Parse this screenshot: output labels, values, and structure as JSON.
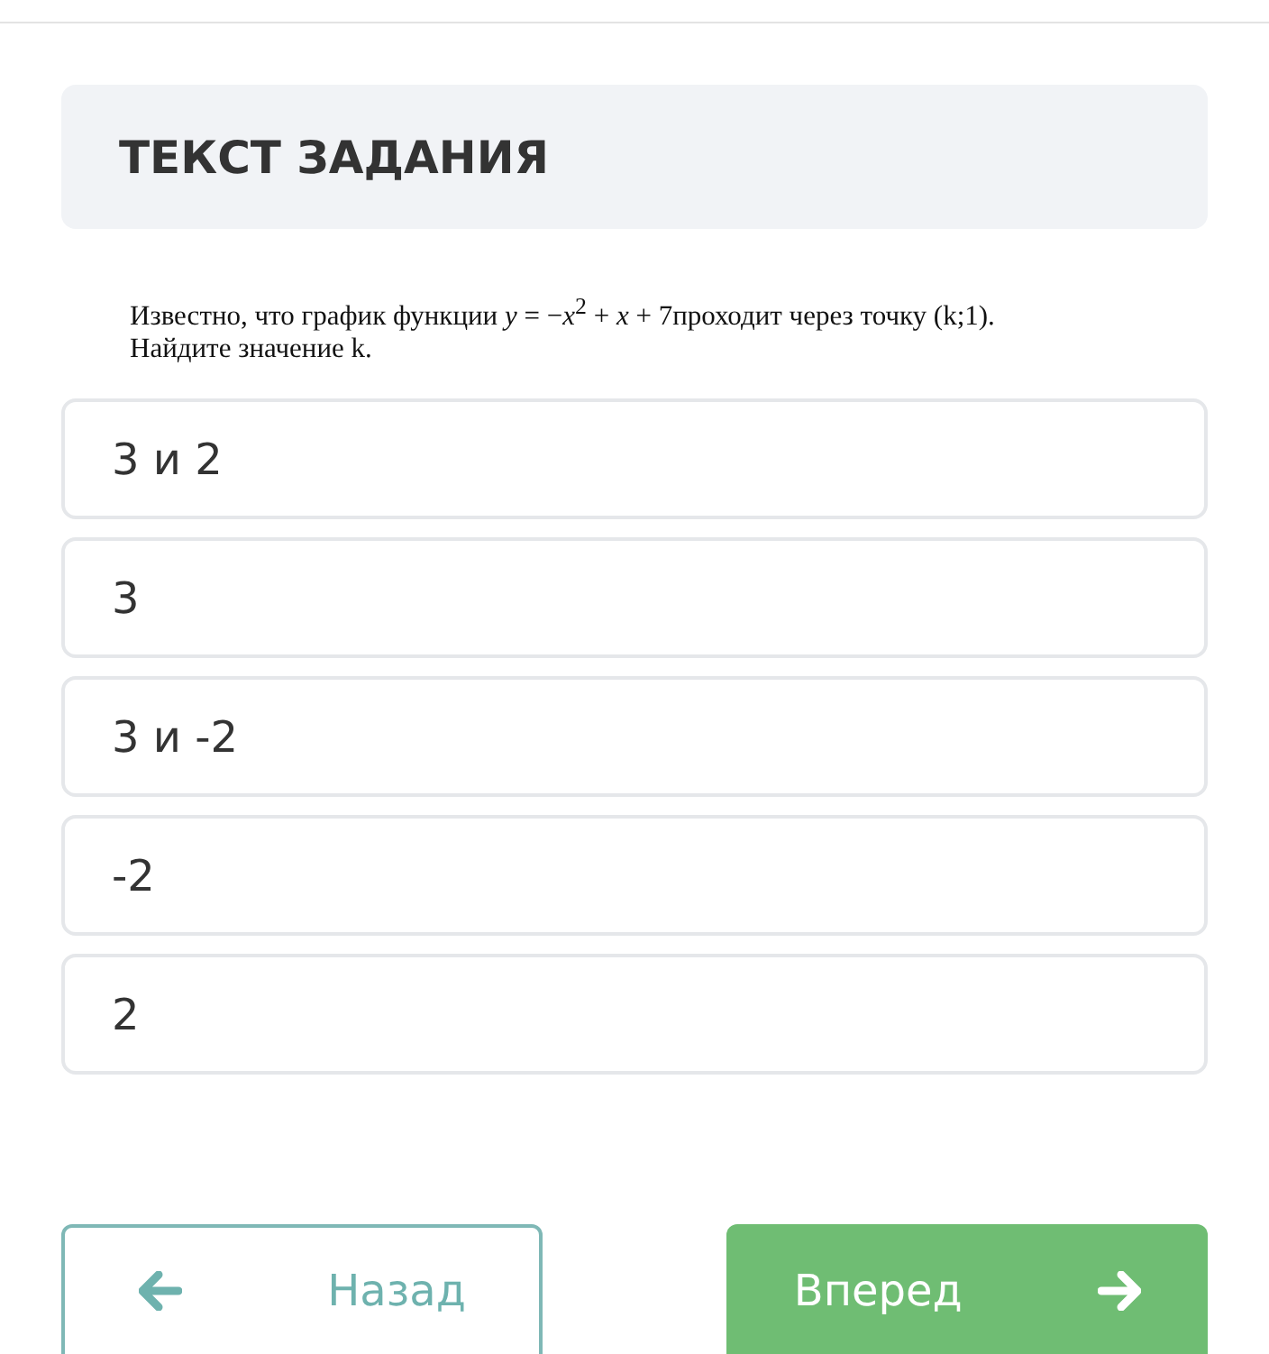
{
  "task_header": {
    "title": "ТЕКСТ ЗАДАНИЯ"
  },
  "question_lines": [
    "Известно, что график функции *y* = −*x*$^{2}$ + *x* + 7проходит через точку (k;1).",
    "Найдите значение k."
  ],
  "options": [
    {
      "label": "3 и 2",
      "selected": false
    },
    {
      "label": "3",
      "selected": false
    },
    {
      "label": "3 и -2",
      "selected": false
    },
    {
      "label": "-2",
      "selected": false
    },
    {
      "label": "2",
      "selected": false
    }
  ],
  "navigation": [
    {
      "kind": "back",
      "label": "Назад"
    },
    {
      "kind": "next",
      "label": "Вперед"
    }
  ]
}
